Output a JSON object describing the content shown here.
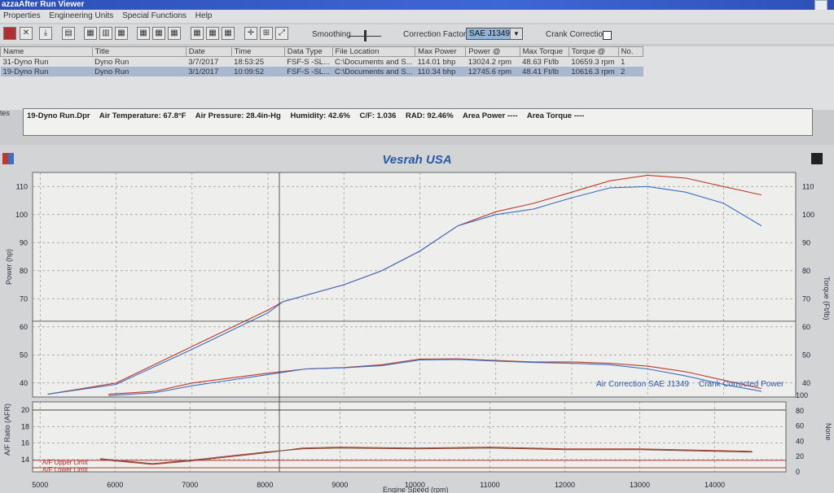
{
  "window": {
    "title": "azzaAfter Run Viewer"
  },
  "menu": [
    "Properties",
    "Engineering Units",
    "Special Functions",
    "Help"
  ],
  "toolbar": {
    "smoothing_label": "Smoothing",
    "correction_label": "Correction Factor",
    "correction_value": "SAE J1349",
    "crank_label": "Crank Correction",
    "crank_checked": false
  },
  "runs_table": {
    "columns": [
      "Name",
      "Title",
      "Date",
      "Time",
      "Data Type",
      "File Location",
      "Max Power",
      "Power @",
      "Max Torque",
      "Torque @",
      "No."
    ],
    "rows": [
      [
        "31-Dyno Run",
        "Dyno Run",
        "3/7/2017",
        "18:53:25",
        "FSF-S -SL...",
        "C:\\Documents and S...",
        "114.01 bhp",
        "13024.2 rpm",
        "48.63 Ft/lb",
        "10659.3 rpm",
        "1"
      ],
      [
        "19-Dyno Run",
        "Dyno Run",
        "3/1/2017",
        "10:09:52",
        "FSF-S -SL...",
        "C:\\Documents and S...",
        "110.34 bhp",
        "12745.6 rpm",
        "48.41 Ft/lb",
        "10616.3 rpm",
        "2"
      ]
    ],
    "selected_row": 1
  },
  "info_tab": "tes",
  "run_info": {
    "file": "19-Dyno Run.Dpr",
    "air_temp": "Air Temperature: 67.8°F",
    "air_pressure": "Air Pressure: 28.4in-Hg",
    "humidity": "Humidity: 42.6%",
    "cf": "C/F: 1.036",
    "rad": "RAD: 92.46%",
    "area_power": "Area Power ----",
    "area_torque": "Area Torque ----"
  },
  "colors": {
    "run1": "#c0392b",
    "run2": "#3a6fc4",
    "title": "#2b5aa8",
    "afr_line": "#b03a2e"
  },
  "chart_data": [
    {
      "type": "line",
      "title": "Vesrah USA",
      "ylabel": "Power (hp)",
      "y2label": "Torque (Ft/lb)",
      "ylim": [
        35,
        115
      ],
      "yticks": [
        40,
        50,
        60,
        70,
        80,
        90,
        100,
        110
      ],
      "xlim": [
        4900,
        14950
      ],
      "grid": true,
      "legend_texts": [
        "Air Correction SAE J1349",
        "Crank Corrected Power"
      ],
      "series": [
        {
          "name": "31-Dyno Run",
          "kind": "power",
          "x": [
            5100,
            6000,
            7000,
            8000,
            8200,
            9000,
            9500,
            10000,
            10500,
            11000,
            11500,
            12000,
            12500,
            13000,
            13500,
            14000,
            14500
          ],
          "values": [
            36,
            40,
            53,
            66,
            69,
            75,
            80,
            87,
            96,
            101,
            104,
            108,
            112,
            114,
            113,
            110,
            107
          ]
        },
        {
          "name": "19-Dyno Run",
          "kind": "power",
          "x": [
            5100,
            6000,
            7000,
            8000,
            8200,
            9000,
            9500,
            10000,
            10500,
            11000,
            11500,
            12000,
            12500,
            13000,
            13500,
            14000,
            14500
          ],
          "values": [
            36,
            39.5,
            52,
            65,
            69,
            75,
            80,
            87,
            96,
            100,
            102,
            106,
            109.5,
            110,
            108,
            104,
            96
          ]
        },
        {
          "name": "31-Dyno Run",
          "kind": "torque",
          "x": [
            5900,
            6500,
            7000,
            8000,
            8500,
            9000,
            9500,
            10000,
            10500,
            11000,
            11500,
            12000,
            12500,
            13000,
            13500,
            14000,
            14500
          ],
          "values": [
            36,
            37,
            40,
            43.5,
            45,
            45.5,
            46.5,
            48.5,
            48.6,
            48,
            47.5,
            47.5,
            47,
            46,
            44,
            41,
            38
          ]
        },
        {
          "name": "19-Dyno Run",
          "kind": "torque",
          "x": [
            5900,
            6500,
            7000,
            8000,
            8500,
            9000,
            9500,
            10000,
            10500,
            11000,
            11500,
            12000,
            12500,
            13000,
            13500,
            14000,
            14500
          ],
          "values": [
            35.5,
            36.5,
            39,
            43,
            45,
            45.4,
            46.2,
            48.2,
            48.4,
            47.8,
            47.3,
            47,
            46.5,
            45,
            42.5,
            39.5,
            37
          ]
        }
      ],
      "cursor": {
        "x": 8150,
        "y": 62
      }
    },
    {
      "type": "line",
      "ylabel": "A/F Ratio (AFR)",
      "y2label": "None",
      "ylim": [
        12.5,
        21
      ],
      "yticks": [
        14,
        16,
        18,
        20
      ],
      "y2ticks": [
        0,
        20,
        40,
        60,
        80,
        100
      ],
      "xlabel": "Engine Speed (rpm)",
      "xticks": [
        5000,
        6000,
        7000,
        8000,
        9000,
        10000,
        11000,
        12000,
        13000,
        14000
      ],
      "xlim": [
        4900,
        14950
      ],
      "upper_limit_label": "A/F Upper Limit",
      "lower_limit_label": "A/F Lower Limit",
      "series": [
        {
          "name": "AFR 31-Dyno Run",
          "x": [
            5800,
            6500,
            7000,
            7500,
            8000,
            8500,
            9000,
            10000,
            11000,
            12000,
            13000,
            14000,
            14500
          ],
          "values": [
            14.0,
            13.4,
            13.8,
            14.3,
            14.8,
            15.4,
            15.5,
            15.4,
            15.5,
            15.3,
            15.3,
            15.1,
            15.0
          ]
        },
        {
          "name": "AFR 19-Dyno Run",
          "x": [
            5800,
            6500,
            7000,
            7500,
            8000,
            8500,
            9000,
            10000,
            11000,
            12000,
            13000,
            14000,
            14500
          ],
          "values": [
            14.1,
            13.5,
            13.9,
            14.4,
            14.9,
            15.3,
            15.4,
            15.3,
            15.4,
            15.2,
            15.2,
            15.0,
            14.9
          ]
        }
      ]
    }
  ]
}
